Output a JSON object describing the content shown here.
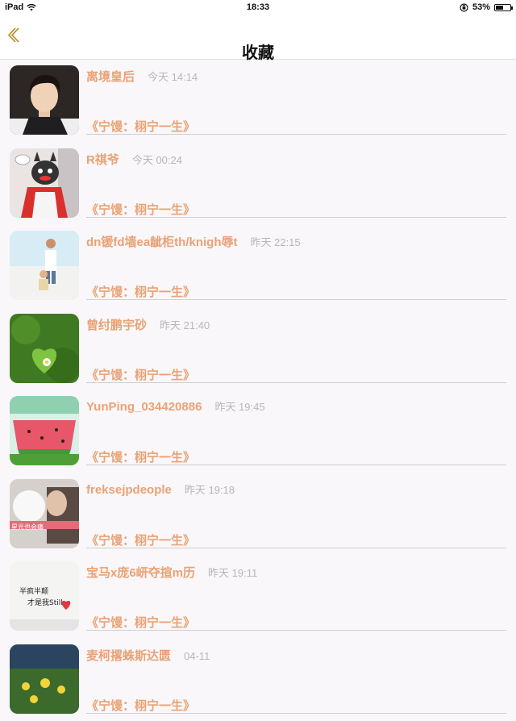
{
  "status_bar": {
    "device": "iPad",
    "time": "18:33",
    "battery": "53%",
    "battery_level": 0.53
  },
  "header": {
    "title": "收藏",
    "back_icon": "chevron-left-icon"
  },
  "colors": {
    "accent": "#e9a276",
    "time_text": "#b7b7b7",
    "divider": "#cfcfcf",
    "background": "#f9f7f9"
  },
  "favorites": [
    {
      "name": "离境皇后",
      "time": "今天 14:14",
      "source": "《宁馒：栩宁一生》",
      "thumb": "portrait-photo"
    },
    {
      "name": "R祺爷",
      "time": "今天 00:24",
      "source": "《宁馒：栩宁一生》",
      "thumb": "cartoon-photo"
    },
    {
      "name": "dn锾fd墙ea龇柜th/knigh辱t",
      "time": "昨天 22:15",
      "source": "《宁馒：栩宁一生》",
      "thumb": "beach-photo"
    },
    {
      "name": "曾纣鹏宇砂",
      "time": "昨天 21:40",
      "source": "《宁馒：栩宁一生》",
      "thumb": "grass-photo"
    },
    {
      "name": "YunPing_034420886",
      "time": "昨天 19:45",
      "source": "《宁馒：栩宁一生》",
      "thumb": "watermelon-photo"
    },
    {
      "name": "freksejpdeople",
      "time": "昨天 19:18",
      "source": "《宁馒：栩宁一生》",
      "thumb": "window-photo",
      "thumb_caption": "星光也会痛"
    },
    {
      "name": "宝马x庞6岍夺揎m历",
      "time": "昨天 19:11",
      "source": "《宁馒：栩宁一生》",
      "thumb": "text-photo",
      "thumb_caption": "半疯半颠 才是我Still"
    },
    {
      "name": "麦柯撂蛛斯达匮",
      "time": "04-11",
      "source": "《宁馒：栩宁一生》",
      "thumb": "flowers-photo"
    }
  ]
}
